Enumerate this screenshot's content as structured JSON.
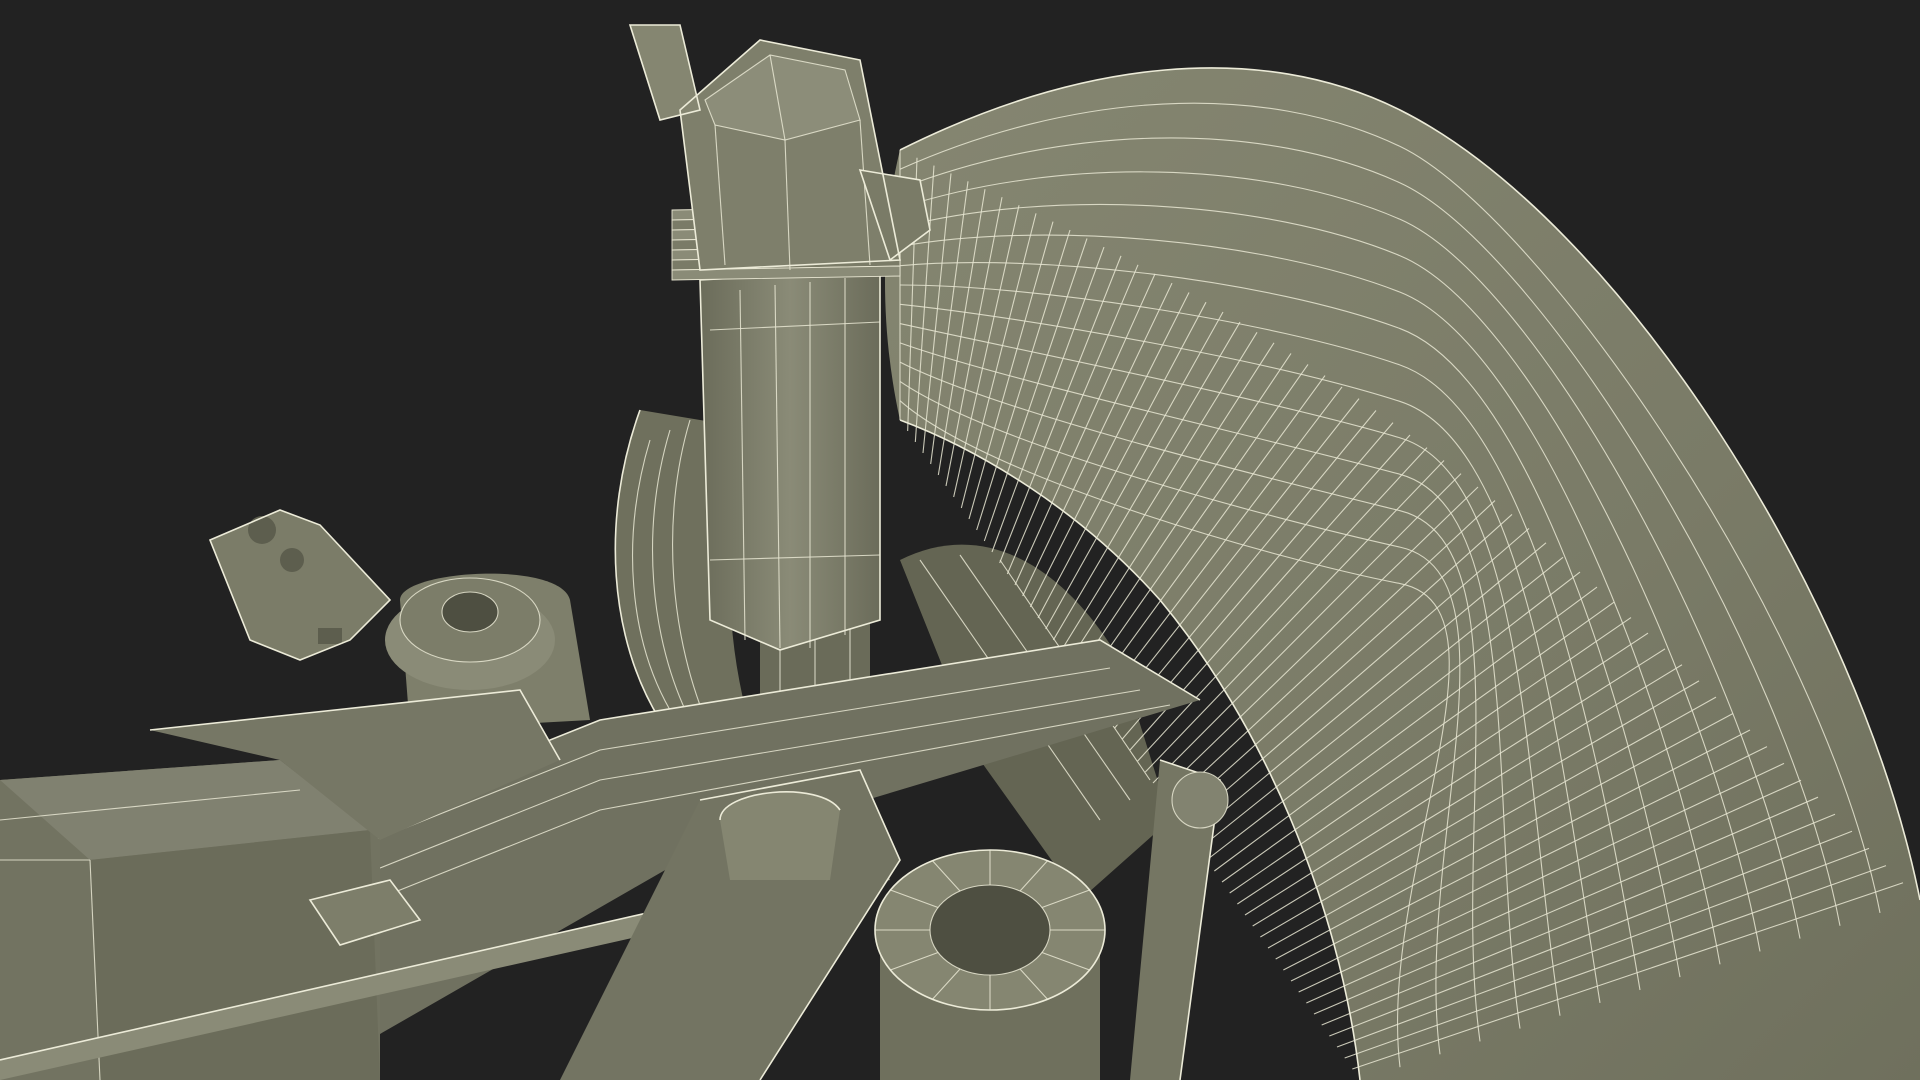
{
  "scene": {
    "subject": "wireframe-3d-model",
    "colors": {
      "background": "#222222",
      "surface": "#7c7d69",
      "surface_light": "#8a8b77",
      "surface_dark": "#5e5f4f",
      "wire": "#e8e6d2"
    }
  }
}
